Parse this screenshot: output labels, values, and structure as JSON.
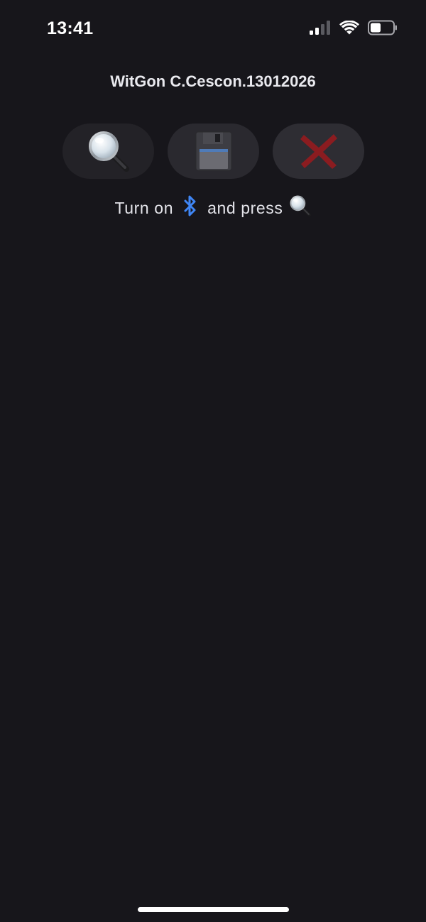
{
  "status_bar": {
    "time": "13:41",
    "icons": [
      "cellular-signal-icon",
      "wifi-icon",
      "battery-icon"
    ]
  },
  "header": {
    "title": "WitGon C.Cescon.13012026"
  },
  "toolbar": {
    "buttons": [
      {
        "name": "search-button",
        "icon": "magnifier-icon"
      },
      {
        "name": "save-button",
        "icon": "floppy-disk-icon"
      },
      {
        "name": "close-button",
        "icon": "cross-icon"
      }
    ]
  },
  "hint": {
    "part1": "Turn on",
    "icon1": "bluetooth-icon",
    "part2": "and press",
    "icon2": "magnifier-icon"
  },
  "colors": {
    "background": "#17161b",
    "button_bg": "#232227",
    "bluetooth": "#3f86f5",
    "cross": "#8b1c20"
  }
}
